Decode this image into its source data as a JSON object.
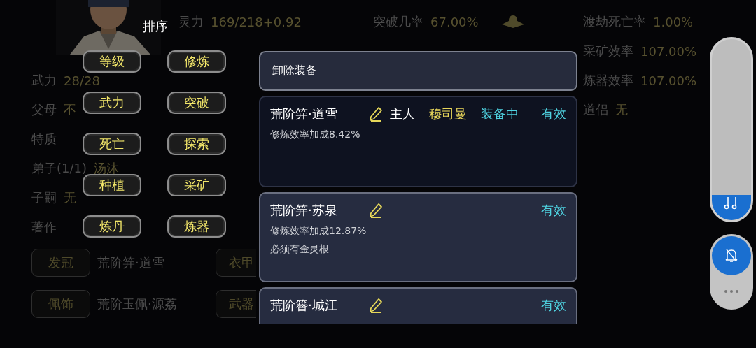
{
  "stat_columns": [
    {
      "stats": [
        {
          "label": "武力",
          "value": "28/28"
        },
        {
          "label": "父母",
          "value": "不"
        },
        {
          "label": "特质"
        },
        {
          "label": "弟子(1/1)",
          "value": "汤沐"
        },
        {
          "label": "子嗣",
          "value": "无"
        },
        {
          "label": "著作"
        }
      ]
    },
    {
      "stats": [
        {
          "label": "灵力",
          "value": "169/218+0.92"
        }
      ]
    },
    {
      "stats": [
        {
          "label": "突破几率",
          "value": "67.00%"
        }
      ]
    },
    {
      "stats": [
        {
          "label": "渡劫死亡率",
          "value": "1.00%"
        },
        {
          "label": "采矿效率",
          "value": "107.00%"
        },
        {
          "label": "炼器效率",
          "value": "107.00%"
        },
        {
          "label": "道侣",
          "value": "无"
        }
      ]
    }
  ],
  "equipment_rows": [
    [
      {
        "slot": "发冠",
        "item": "荒阶笄·道雪"
      },
      {
        "slot": "衣甲"
      }
    ],
    [
      {
        "slot": "佩饰",
        "item": "荒阶玉佩·源荔"
      },
      {
        "slot": "武器"
      }
    ]
  ],
  "sort_menu": {
    "title": "排序",
    "options": [
      "等级",
      "修炼",
      "武力",
      "突破",
      "死亡",
      "探索",
      "种植",
      "采矿",
      "炼丹",
      "炼器"
    ]
  },
  "equip_panel": {
    "header": "卸除装备",
    "cards": [
      {
        "kind": "equipped",
        "name": "荒阶笄·道雪",
        "owner_label": "主人",
        "owner": "穆司曼",
        "status": "装备中",
        "validity": "有效",
        "effects": [
          "修炼效率加成8.42%"
        ]
      },
      {
        "kind": "item",
        "name": "荒阶笄·苏泉",
        "validity": "有效",
        "effects": [
          "修炼效率加成12.87%",
          "必须有金灵根"
        ]
      },
      {
        "kind": "item",
        "name": "荒阶簪·城江",
        "validity": "有效"
      }
    ]
  },
  "volume": {
    "level": 0.14
  }
}
